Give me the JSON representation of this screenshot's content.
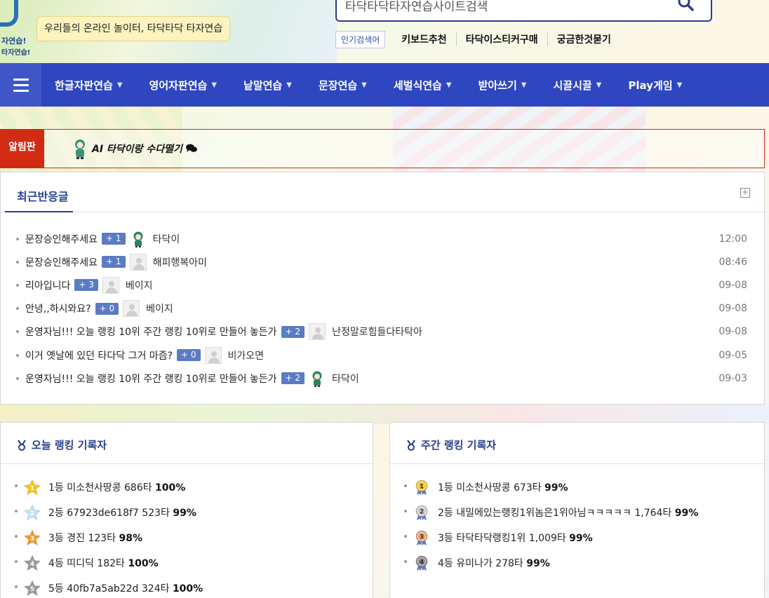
{
  "brand": {
    "logo_line1": "자연습!",
    "logo_line2": "타자연습!",
    "tagline": "우리들의 온라인 놀이터, 타닥타닥 타자연습"
  },
  "search": {
    "value": "타닥타닥타자연습사이트검색",
    "button_icon": "search-icon"
  },
  "popular": {
    "label": "인기검색어",
    "items": [
      "키보드추천",
      "타닥이스티커구매",
      "궁금한것묻기"
    ]
  },
  "nav": {
    "menu_icon": "hamburger-icon",
    "items": [
      "한글자판연습",
      "영어자판연습",
      "낱말연습",
      "문장연습",
      "세벌식연습",
      "받아쓰기",
      "시끌시끌",
      "Play게임"
    ]
  },
  "notice": {
    "label": "알림판",
    "text": "AI 타닥이랑 수다떨기",
    "icon": "chat-icon"
  },
  "recent": {
    "title": "최근반응글",
    "more_icon": "plus-square-icon",
    "rows": [
      {
        "subject": "문장승인해주세요",
        "count": "+ 1",
        "avatar": "character",
        "nick": "타닥이",
        "date": "12:00"
      },
      {
        "subject": "문장승인해주세요",
        "count": "+ 1",
        "avatar": "default",
        "nick": "해피행복아미",
        "date": "08:46"
      },
      {
        "subject": "리아입니다",
        "count": "+ 3",
        "avatar": "default",
        "nick": "베이지",
        "date": "09-08"
      },
      {
        "subject": "안녕,,하시와요?",
        "count": "+ 0",
        "avatar": "default",
        "nick": "베이지",
        "date": "09-08"
      },
      {
        "subject": "운영자님!!! 오늘 랭킹 10위 주간 랭킹 10위로 만들어 놓든가",
        "count": "+ 2",
        "avatar": "default",
        "nick": "난정말로힘들다타탁아",
        "date": "09-08"
      },
      {
        "subject": "이거 옛날에 있던 타다닥 그거 마즘?",
        "count": "+ 0",
        "avatar": "default",
        "nick": "비가오면",
        "date": "09-05"
      },
      {
        "subject": "운영자님!!! 오늘 랭킹 10위 주간 랭킹 10위로 만들어 놓든가",
        "count": "+ 2",
        "avatar": "character",
        "nick": "타닥이",
        "date": "09-03"
      }
    ]
  },
  "today_rank": {
    "title": "오늘 랭킹 기록자",
    "icon": "medal-icon",
    "items": [
      {
        "text": "1등 미소천사땅콩 686타",
        "pct": "100%",
        "medal": "star-gold",
        "color": "#f5c518",
        "num": "1"
      },
      {
        "text": "2등 67923de618f7 523타",
        "pct": "99%",
        "medal": "star-light",
        "color": "#bfe3f5",
        "num": "2"
      },
      {
        "text": "3등 경진 123타",
        "pct": "98%",
        "medal": "star-orange",
        "color": "#f29a2e",
        "num": "3"
      },
      {
        "text": "4등 띠디딕 182타",
        "pct": "100%",
        "medal": "star-gray",
        "color": "#9a9a9a",
        "num": "4"
      },
      {
        "text": "5등 40fb7a5ab22d 324타",
        "pct": "100%",
        "medal": "star-gray",
        "color": "#9a9a9a",
        "num": "5"
      }
    ]
  },
  "week_rank": {
    "title": "주간 랭킹 기록자",
    "icon": "medal-icon",
    "items": [
      {
        "text": "1등 미소천사땅콩 673타",
        "pct": "99%",
        "medal": "badge-gold",
        "color": "#f3c33b",
        "num": "1"
      },
      {
        "text": "2등 내밀에있는랭킹1위놈은1위아님ㅋㅋㅋㅋㅋ 1,764타",
        "pct": "99%",
        "medal": "badge-silver",
        "color": "#c9c9c9",
        "num": "2"
      },
      {
        "text": "3등 타닥타닥랭킹1위 1,009타",
        "pct": "99%",
        "medal": "badge-bronze",
        "color": "#e8a070",
        "num": "3"
      },
      {
        "text": "4등 유미나가 278타",
        "pct": "99%",
        "medal": "badge-gray",
        "color": "#8a8a8a",
        "num": "4"
      }
    ]
  }
}
